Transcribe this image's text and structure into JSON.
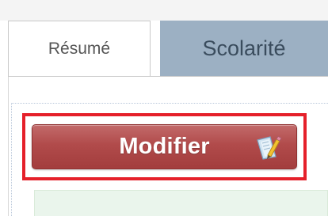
{
  "tabs": [
    {
      "label": "Résumé",
      "active": true
    },
    {
      "label": "Scolarité",
      "active": false
    }
  ],
  "toolbar": {
    "modify_label": "Modifier",
    "modify_icon": "edit-pencil-icon",
    "button_color": "#b14b4b",
    "highlight_color": "#e5202a"
  },
  "colors": {
    "inactive_tab": "#9cb0c3",
    "info_box": "#eaf5ec"
  }
}
